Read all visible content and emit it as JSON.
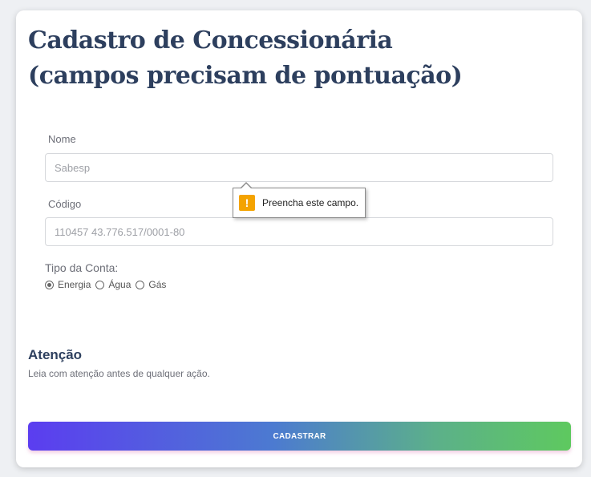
{
  "title": "Cadastro de Concessionária (campos precisam de pontuação)",
  "form": {
    "nome": {
      "label": "Nome",
      "placeholder": "Sabesp",
      "value": ""
    },
    "codigo": {
      "label": "Código",
      "placeholder": "110457 43.776.517/0001-80",
      "value": ""
    },
    "tipo_conta": {
      "label": "Tipo da Conta:",
      "options": [
        {
          "label": "Energia",
          "checked": true
        },
        {
          "label": "Água",
          "checked": false
        },
        {
          "label": "Gás",
          "checked": false
        }
      ]
    }
  },
  "attention": {
    "title": "Atenção",
    "text": "Leia com atenção antes de qualquer ação."
  },
  "submit_label": "CADASTRAR",
  "validation_tooltip": {
    "icon": "warning-icon",
    "text": "Preencha este campo."
  },
  "colors": {
    "title": "#2d3f5e",
    "gradient_start": "#5b3df0",
    "gradient_end": "#5ec95f",
    "warning": "#f4a300"
  }
}
